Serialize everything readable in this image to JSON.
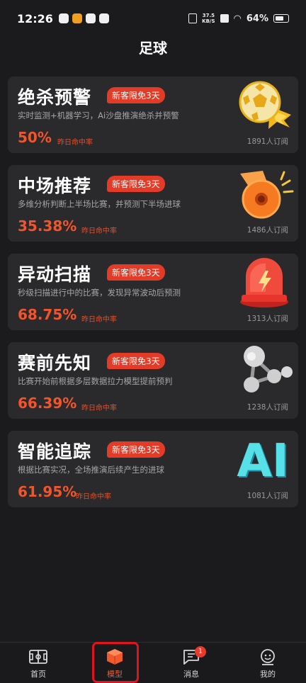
{
  "status_bar": {
    "time": "12:26",
    "net_speed_value": "37.5",
    "net_speed_unit": "KB/S",
    "battery": "64%"
  },
  "page_title": "足球",
  "badge_text": "新客限免3天",
  "rate_label": "昨日命中率",
  "cards": [
    {
      "title": "绝杀预警",
      "desc": "实时监测+机器学习，Ai沙盘推演绝杀并预警",
      "rate": "50%",
      "subscribers": "1891人订阅",
      "icon": "soccer-ball-icon"
    },
    {
      "title": "中场推荐",
      "desc": "多维分析判断上半场比赛，并预测下半场进球",
      "rate": "35.38%",
      "subscribers": "1486人订阅",
      "icon": "whistle-icon"
    },
    {
      "title": "异动扫描",
      "desc": "秒级扫描进行中的比赛，发现异常波动后预测",
      "rate": "68.75%",
      "subscribers": "1313人订阅",
      "icon": "alarm-light-icon"
    },
    {
      "title": "赛前先知",
      "desc": "比赛开始前根据多层数据拉力模型提前预判",
      "rate": "66.39%",
      "subscribers": "1238人订阅",
      "icon": "molecule-icon"
    },
    {
      "title": "智能追踪",
      "desc": "根据比赛实况，全场推演后续产生的进球",
      "rate": "61.95%",
      "subscribers": "1081人订阅",
      "icon": "ai-text-icon"
    }
  ],
  "ai_icon_text": "AI",
  "nav": {
    "home": "首页",
    "model": "模型",
    "messages": "消息",
    "messages_badge": "1",
    "profile": "我的"
  },
  "colors": {
    "background": "#1b1b1d",
    "card": "#2a2a2c",
    "accent": "#f2552c",
    "badge": "#e23b27",
    "highlight_frame": "#e0141f"
  }
}
